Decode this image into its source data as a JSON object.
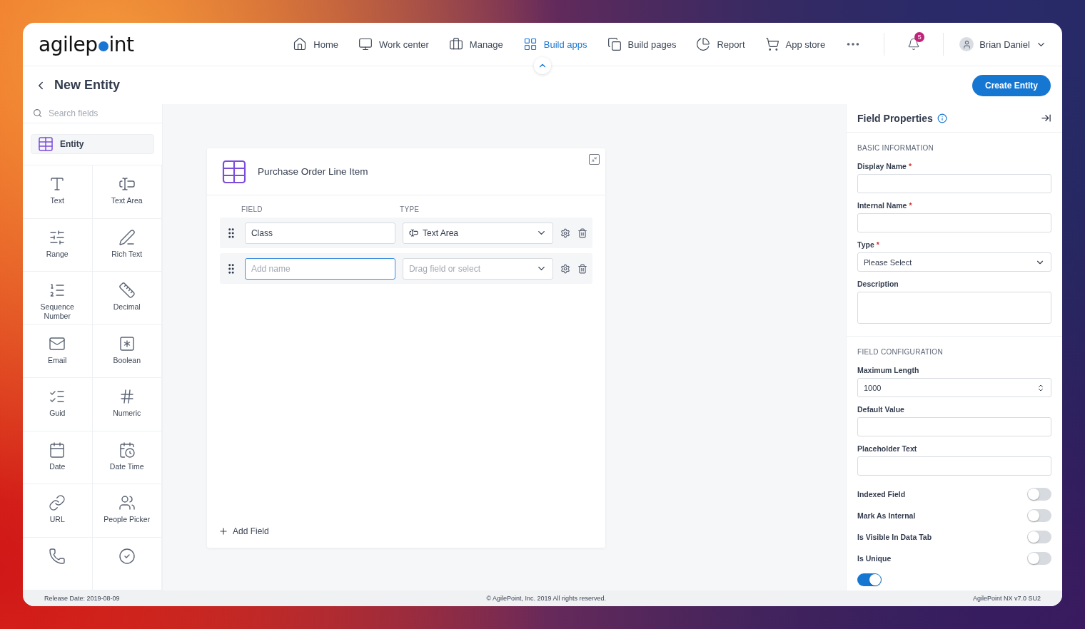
{
  "logo": {
    "before": "agilep",
    "after": "int"
  },
  "nav": [
    {
      "label": "Home",
      "selected": false
    },
    {
      "label": "Work center",
      "selected": false
    },
    {
      "label": "Manage",
      "selected": false
    },
    {
      "label": "Build apps",
      "selected": true
    },
    {
      "label": "Build pages",
      "selected": false
    },
    {
      "label": "Report",
      "selected": false
    },
    {
      "label": "App store",
      "selected": false
    }
  ],
  "notifications": {
    "count": "5"
  },
  "user": {
    "name": "Brian Daniel"
  },
  "page": {
    "title": "New Entity",
    "primary_button": "Create Entity"
  },
  "sidebar": {
    "search": {
      "placeholder": "Search fields"
    },
    "entity": "Entity",
    "fields": [
      {
        "label": "Text"
      },
      {
        "label": "Text Area"
      },
      {
        "label": "Range"
      },
      {
        "label": "Rich Text"
      },
      {
        "label": "Sequence Number"
      },
      {
        "label": "Decimal"
      },
      {
        "label": "Email"
      },
      {
        "label": "Boolean"
      },
      {
        "label": "Guid"
      },
      {
        "label": "Numeric"
      },
      {
        "label": "Date"
      },
      {
        "label": "Date Time"
      },
      {
        "label": "URL"
      },
      {
        "label": "People Picker"
      },
      {
        "label_cut": true
      },
      {
        "label_cut": true
      }
    ]
  },
  "entity_card": {
    "title": "Purchase Order Line Item",
    "columns": [
      "FIELD",
      "TYPE"
    ],
    "rows": [
      {
        "name": "Class",
        "type": "Text Area",
        "focused": false
      },
      {
        "name_placeholder": "Add name",
        "type_placeholder": "Drag field or select",
        "focused": true
      }
    ],
    "add_button": "Add Field"
  },
  "properties": {
    "title": "Field Properties",
    "sections": [
      {
        "heading": "BASIC INFORMATION",
        "fields": [
          {
            "kind": "text",
            "label": "Display Name",
            "required_mark": "*"
          },
          {
            "kind": "text",
            "label": "Internal Name",
            "required_mark": "*"
          },
          {
            "kind": "select",
            "label": "Type",
            "required_mark": "*",
            "value": "Please Select"
          },
          {
            "kind": "textarea",
            "label": "Description"
          }
        ]
      },
      {
        "heading": "FIELD CONFIGURATION",
        "fields": [
          {
            "kind": "number",
            "label": "Maximum Length",
            "value": "1000"
          },
          {
            "kind": "text",
            "label": "Default Value"
          },
          {
            "kind": "text",
            "label": "Placeholder Text"
          },
          {
            "kind": "toggle",
            "label": "Indexed Field",
            "on": false
          },
          {
            "kind": "toggle",
            "label": "Mark As Internal",
            "on": false
          },
          {
            "kind": "toggle",
            "label": "Is Visible In Data Tab",
            "on": false
          },
          {
            "kind": "toggle",
            "label": "Is Unique",
            "on": false
          },
          {
            "kind": "toggle",
            "on": true
          }
        ]
      }
    ]
  },
  "footer": {
    "left": "Release Date: 2019-08-09",
    "center": "© AgilePoint, Inc. 2019 All rights reserved.",
    "right": "AgilePoint NX v7.0 SU2"
  }
}
